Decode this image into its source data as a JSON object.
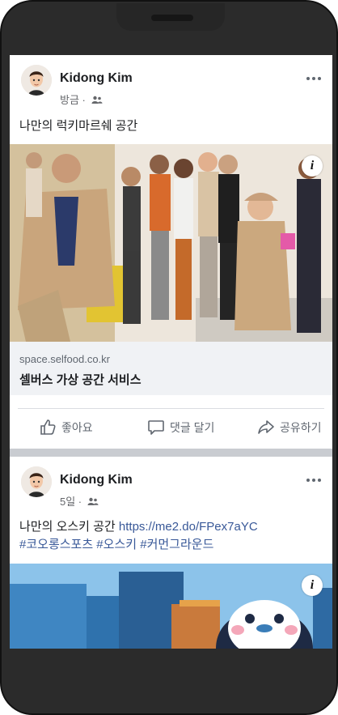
{
  "posts": [
    {
      "author": "Kidong Kim",
      "time": "방금 ·",
      "caption": "나만의 럭키마르쉐 공간",
      "link_domain": "space.selfood.co.kr",
      "link_title": "셀버스 가상 공간 서비스",
      "actions": {
        "like": "좋아요",
        "comment": "댓글 달기",
        "share": "공유하기"
      }
    },
    {
      "author": "Kidong Kim",
      "time": "5일 ·",
      "caption_text": "나만의 오스키 공간 ",
      "caption_url": "https://me2.do/FPex7aYC",
      "hashtags": "#코오롱스포츠 #오스키 #커먼그라운드"
    }
  ],
  "icons": {
    "more": "more-icon",
    "friends": "friends-icon",
    "info": "info-icon",
    "like": "thumbs-up-icon",
    "comment": "comment-icon",
    "share": "share-icon"
  },
  "colors": {
    "link": "#385898",
    "secondary_text": "#65676b",
    "divider": "#c9ccd1",
    "link_box_bg": "#f0f2f5"
  }
}
